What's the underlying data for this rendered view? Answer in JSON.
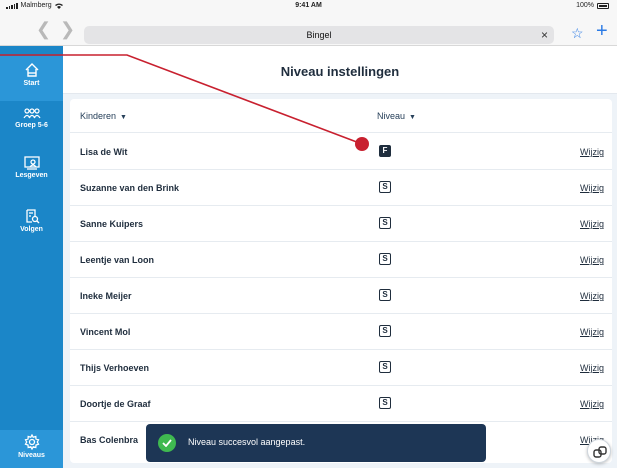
{
  "status_bar": {
    "carrier": "Malmberg",
    "time": "9:41 AM",
    "battery": "100%"
  },
  "browser": {
    "back_icon": "chevron-left",
    "forward_icon": "chevron-right",
    "url_text": "Bingel",
    "clear_icon": "×",
    "bookmark_icon": "☆",
    "new_tab_icon": "+"
  },
  "sidebar": {
    "items": [
      {
        "label": "Start",
        "icon": "home-icon"
      },
      {
        "label": "Groep 5-6",
        "icon": "group-icon"
      },
      {
        "label": "Lesgeven",
        "icon": "teach-icon"
      },
      {
        "label": "Volgen",
        "icon": "track-icon"
      },
      {
        "label": "Niveaus",
        "icon": "gear-icon"
      }
    ]
  },
  "header": {
    "title": "Niveau instellingen"
  },
  "table": {
    "columns": {
      "kinderen": "Kinderen",
      "niveau": "Niveau"
    },
    "action_label": "Wijzig",
    "rows": [
      {
        "name": "Lisa de Wit",
        "level": "F",
        "filled": true
      },
      {
        "name": "Suzanne van den Brink",
        "level": "S",
        "filled": false
      },
      {
        "name": "Sanne Kuipers",
        "level": "S",
        "filled": false
      },
      {
        "name": "Leentje van Loon",
        "level": "S",
        "filled": false
      },
      {
        "name": "Ineke Meijer",
        "level": "S",
        "filled": false
      },
      {
        "name": "Vincent Mol",
        "level": "S",
        "filled": false
      },
      {
        "name": "Thijs Verhoeven",
        "level": "S",
        "filled": false
      },
      {
        "name": "Doortje de Graaf",
        "level": "S",
        "filled": false
      },
      {
        "name": "Bas Colenbra",
        "level": "",
        "filled": false
      }
    ]
  },
  "toast": {
    "message": "Niveau succesvol aangepast."
  },
  "colors": {
    "sidebar": "#1b86c8",
    "toast": "#1d3655",
    "annotation": "#c8202f",
    "success": "#3fb950"
  }
}
